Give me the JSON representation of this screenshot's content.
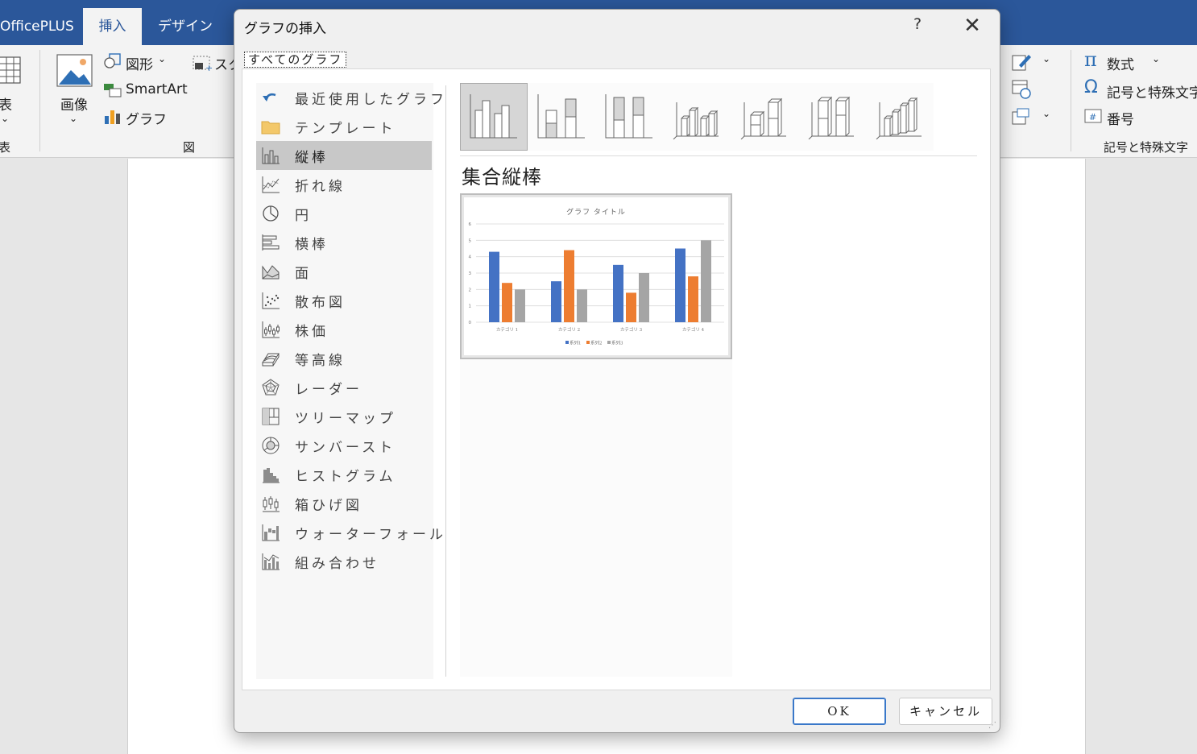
{
  "word": {
    "tabs": [
      "OfficePLUS",
      "挿入",
      "デザイン"
    ],
    "active_tab": "挿入",
    "ribbon_left": {
      "table_label": "表",
      "table_group": "表",
      "image_label": "画像",
      "shapes_label": "図形",
      "smartart_label": "SmartArt",
      "chart_label": "グラフ",
      "screenshot_label": "スク",
      "group_label": "図"
    },
    "ribbon_right": {
      "equation_label": "数式",
      "symbol_label": "記号と特殊文字",
      "number_label": "番号",
      "group_label": "記号と特殊文字"
    }
  },
  "dialog": {
    "title": "グラフの挿入",
    "help": "?",
    "close": "✕",
    "tab_label": "すべてのグラフ",
    "categories": [
      {
        "label": "最近使用したグラフ",
        "icon": "recent-icon"
      },
      {
        "label": "テンプレート",
        "icon": "folder-icon"
      },
      {
        "label": "縦棒",
        "icon": "column-chart-icon",
        "selected": true
      },
      {
        "label": "折れ線",
        "icon": "line-chart-icon"
      },
      {
        "label": "円",
        "icon": "pie-chart-icon"
      },
      {
        "label": "横棒",
        "icon": "bar-chart-icon"
      },
      {
        "label": "面",
        "icon": "area-chart-icon"
      },
      {
        "label": "散布図",
        "icon": "scatter-chart-icon"
      },
      {
        "label": "株価",
        "icon": "stock-chart-icon"
      },
      {
        "label": "等高線",
        "icon": "surface-chart-icon"
      },
      {
        "label": "レーダー",
        "icon": "radar-chart-icon"
      },
      {
        "label": "ツリーマップ",
        "icon": "treemap-icon"
      },
      {
        "label": "サンバースト",
        "icon": "sunburst-icon"
      },
      {
        "label": "ヒストグラム",
        "icon": "histogram-icon"
      },
      {
        "label": "箱ひげ図",
        "icon": "boxwhisker-icon"
      },
      {
        "label": "ウォーターフォール",
        "icon": "waterfall-icon"
      },
      {
        "label": "組み合わせ",
        "icon": "combo-chart-icon"
      }
    ],
    "selected_subtype_title": "集合縦棒",
    "ok_label": "OK",
    "cancel_label": "キャンセル"
  },
  "chart_data": {
    "type": "bar",
    "title": "グラフ タイトル",
    "categories": [
      "カテゴリ 1",
      "カテゴリ 2",
      "カテゴリ 3",
      "カテゴリ 4"
    ],
    "series": [
      {
        "name": "系列1",
        "values": [
          4.3,
          2.5,
          3.5,
          4.5
        ],
        "color": "#4472c4"
      },
      {
        "name": "系列2",
        "values": [
          2.4,
          4.4,
          1.8,
          2.8
        ],
        "color": "#ed7d31"
      },
      {
        "name": "系列3",
        "values": [
          2,
          2,
          3,
          5
        ],
        "color": "#a5a5a5"
      }
    ],
    "yticks": [
      "0",
      "1",
      "2",
      "3",
      "4",
      "5",
      "6"
    ],
    "ylim": [
      0,
      6
    ],
    "grid": true,
    "legend": "bottom"
  }
}
